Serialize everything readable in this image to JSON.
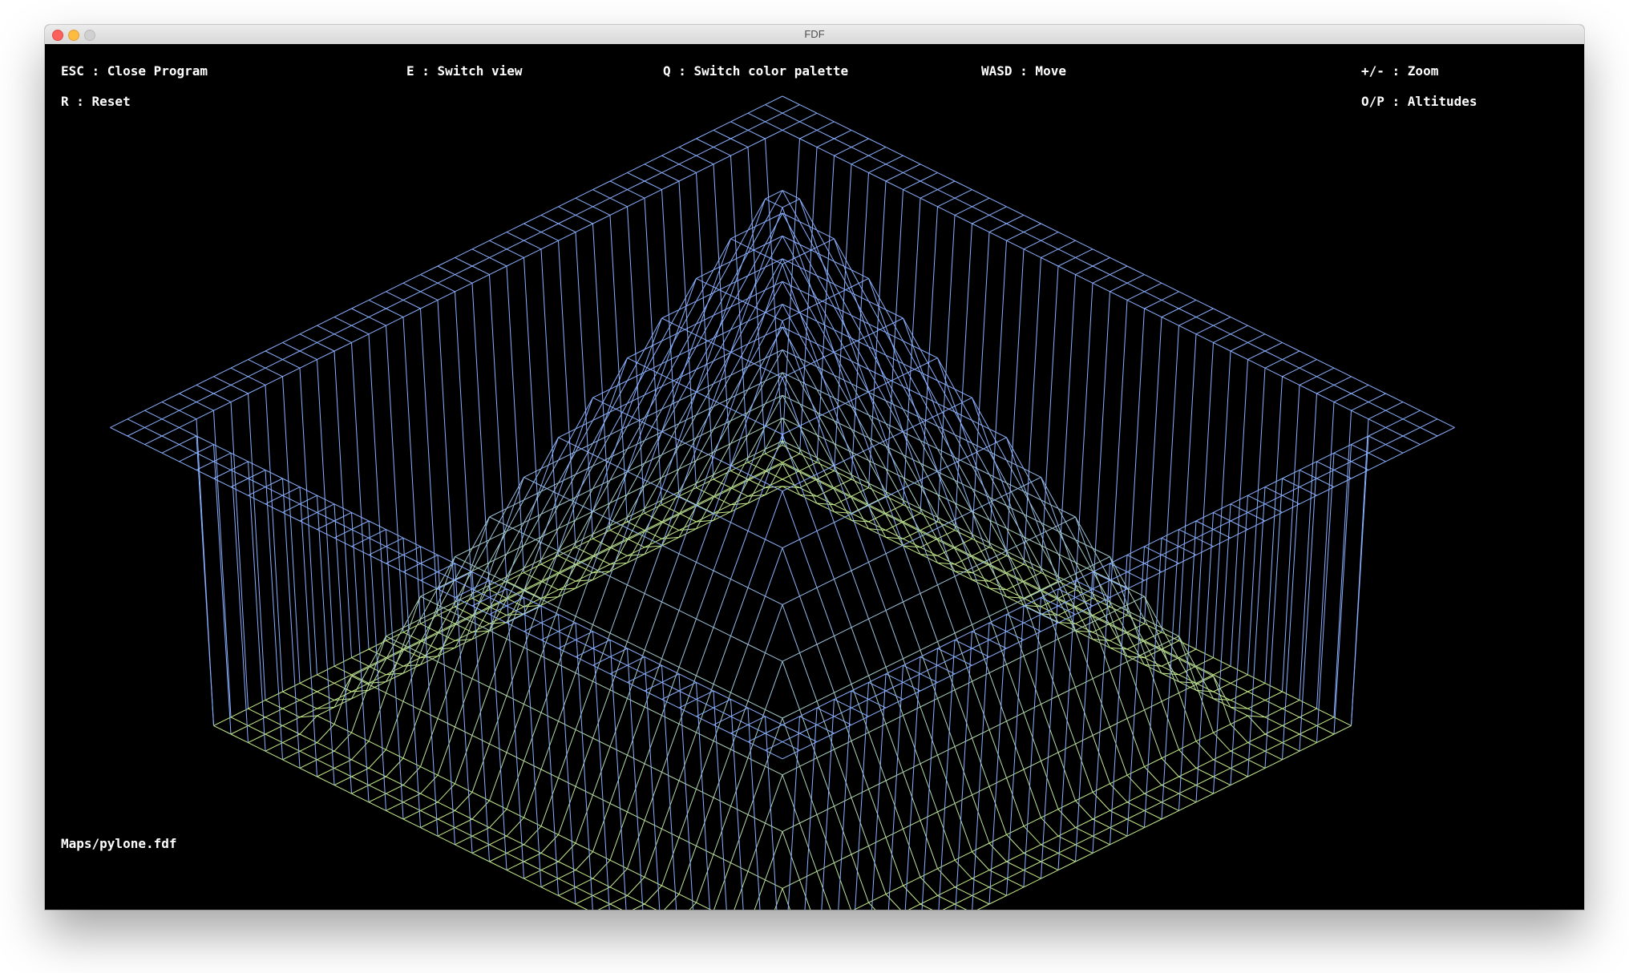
{
  "window": {
    "title": "FDF"
  },
  "hud": {
    "esc": "ESC : Close Program",
    "switch_view": "E : Switch view",
    "switch_palette": "Q : Switch color palette",
    "move": "WASD : Move",
    "zoom": "+/- : Zoom",
    "reset": "R : Reset",
    "altitudes": "O/P : Altitudes",
    "map_file": "Maps/pylone.fdf"
  },
  "palette": {
    "low": "#c8ee8a",
    "high": "#8ab0ff",
    "background": "#000000"
  }
}
